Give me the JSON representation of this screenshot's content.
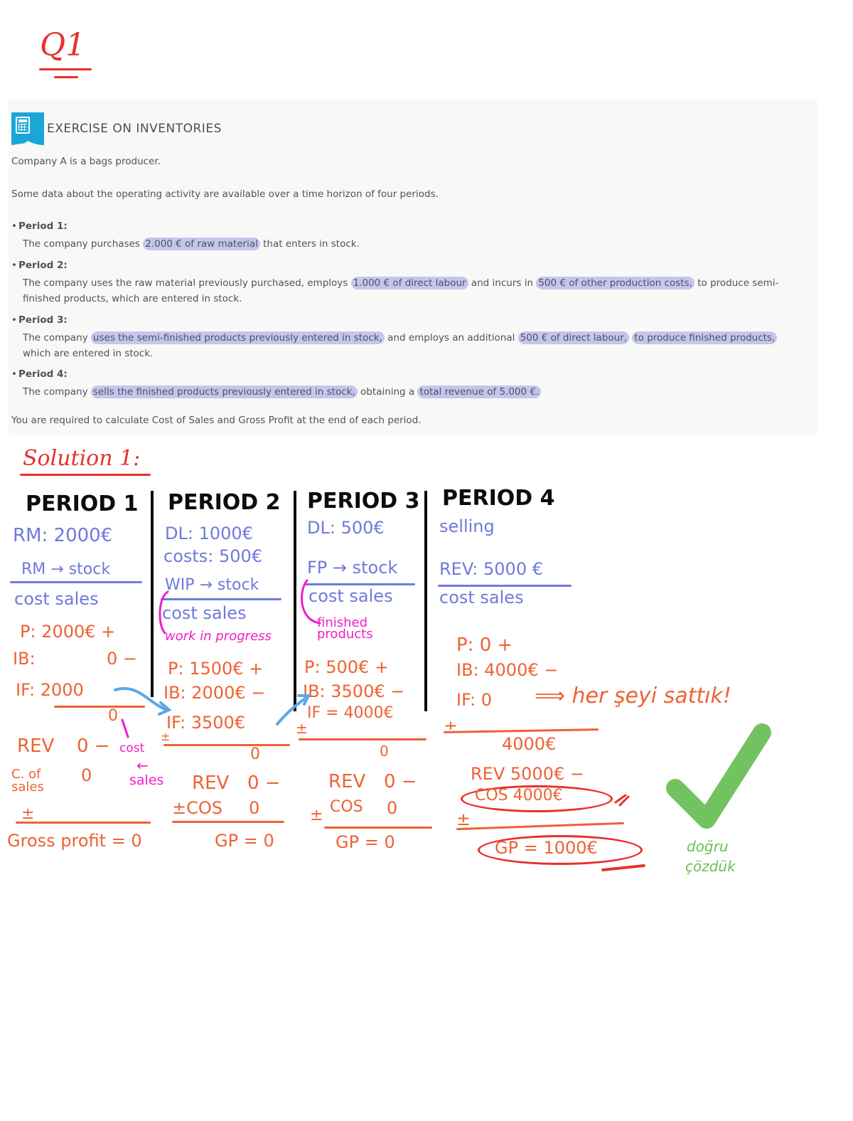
{
  "question_label": "Q1",
  "exercise": {
    "icon": "calculator-icon",
    "title": "EXERCISE ON INVENTORIES",
    "intro_1": "Company A is a bags producer.",
    "intro_2": "Some data about the operating activity are available over a time horizon of four periods.",
    "periods": [
      {
        "title": "Period 1:",
        "segments": [
          {
            "text": "The company purchases ",
            "highlight": false
          },
          {
            "text": "2.000 € of raw material",
            "highlight": true
          },
          {
            "text": " that enters in stock.",
            "highlight": false
          }
        ]
      },
      {
        "title": "Period 2:",
        "segments": [
          {
            "text": "The company uses the raw material previously purchased, employs ",
            "highlight": false
          },
          {
            "text": "1.000 € of direct labour",
            "highlight": true
          },
          {
            "text": " and incurs in ",
            "highlight": false
          },
          {
            "text": "500 € of other production costs,",
            "highlight": true
          },
          {
            "text": " to produce semi-finished products, which are entered in stock.",
            "highlight": false
          }
        ]
      },
      {
        "title": "Period 3:",
        "segments": [
          {
            "text": "The company ",
            "highlight": false
          },
          {
            "text": "uses the semi-finished products previously entered in stock,",
            "highlight": true
          },
          {
            "text": " and employs an additional ",
            "highlight": false
          },
          {
            "text": "500 € of direct labour,",
            "highlight": true
          },
          {
            "text": " ",
            "highlight": false
          },
          {
            "text": "to produce finished products,",
            "highlight": true
          },
          {
            "text": " which are entered in stock.",
            "highlight": false
          }
        ]
      },
      {
        "title": "Period 4:",
        "segments": [
          {
            "text": "The company ",
            "highlight": false
          },
          {
            "text": "sells the finished products previously entered in stock,",
            "highlight": true
          },
          {
            "text": " obtaining a ",
            "highlight": false
          },
          {
            "text": "total revenue of 5.000 €.",
            "highlight": true
          }
        ]
      }
    ],
    "requirement": "You are required to calculate Cost of Sales and Gross Profit at the end of each period."
  },
  "solution": {
    "title": "Solution 1:",
    "columns": [
      {
        "header": "PERIOD 1",
        "notes": [
          "RM: 2000€",
          "RM → stock"
        ],
        "cost_sales_label": "cost sales",
        "calc": {
          "p": "P: 2000€ +",
          "ib": "IB:",
          "ib_val": "0 −",
          "if": "IF: 2000",
          "result": "0"
        },
        "income": {
          "rev": "REV",
          "rev_val": "0 −",
          "cos": "C. of sales",
          "cos_val": "0",
          "pm": "±",
          "gp": "Gross profit = 0"
        },
        "annotation": {
          "top": "cost",
          "arrow": "←",
          "bottom": "sales"
        }
      },
      {
        "header": "PERIOD 2",
        "notes": [
          "DL: 1000€",
          "costs: 500€",
          "WIP → stock"
        ],
        "cost_sales_label": "cost sales",
        "annotation": "work in progress",
        "calc": {
          "p": "P: 1500€ +",
          "ib": "IB: 2000€ −",
          "if": "IF: 3500€",
          "pm": "±",
          "result": "0"
        },
        "income": {
          "rev": "REV",
          "rev_val": "0 −",
          "cos": "±COS",
          "cos_val": "0",
          "gp": "GP = 0"
        }
      },
      {
        "header": "PERIOD 3",
        "notes": [
          "DL: 500€",
          "FP → stock"
        ],
        "cost_sales_label": "cost sales",
        "annotation": "finished products",
        "calc": {
          "p": "P: 500€ +",
          "ib": "IB: 3500€ −",
          "if": "IF = 4000€",
          "pm": "±",
          "result": "0"
        },
        "income": {
          "rev": "REV",
          "rev_val": "0 −",
          "cos": "COS",
          "cos_val": "0",
          "pm": "±",
          "gp": "GP = 0"
        }
      },
      {
        "header": "PERIOD 4",
        "notes": [
          "selling",
          "REV: 5000 €"
        ],
        "cost_sales_label": "cost sales",
        "calc": {
          "p": "P: 0 +",
          "ib": "IB: 4000€ −",
          "if": "IF: 0",
          "comment": "⟹ her şeyi sattık!",
          "pm": "±",
          "result": "4000€"
        },
        "income": {
          "rev": "REV 5000€ −",
          "cos": "COS 4000€",
          "pm": "±",
          "gp": "GP = 1000€"
        }
      }
    ],
    "verdict": {
      "icon": "checkmark-icon",
      "line1": "doğru",
      "line2": "çözdük"
    },
    "colors": {
      "red": "#e8302a",
      "blue": "#6f79dc",
      "orange": "#ee6233",
      "magenta": "#ef1fc8",
      "green": "#6cbf57",
      "highlight": "#c4c6ee",
      "calc_badge": "#1aa6d6"
    }
  }
}
